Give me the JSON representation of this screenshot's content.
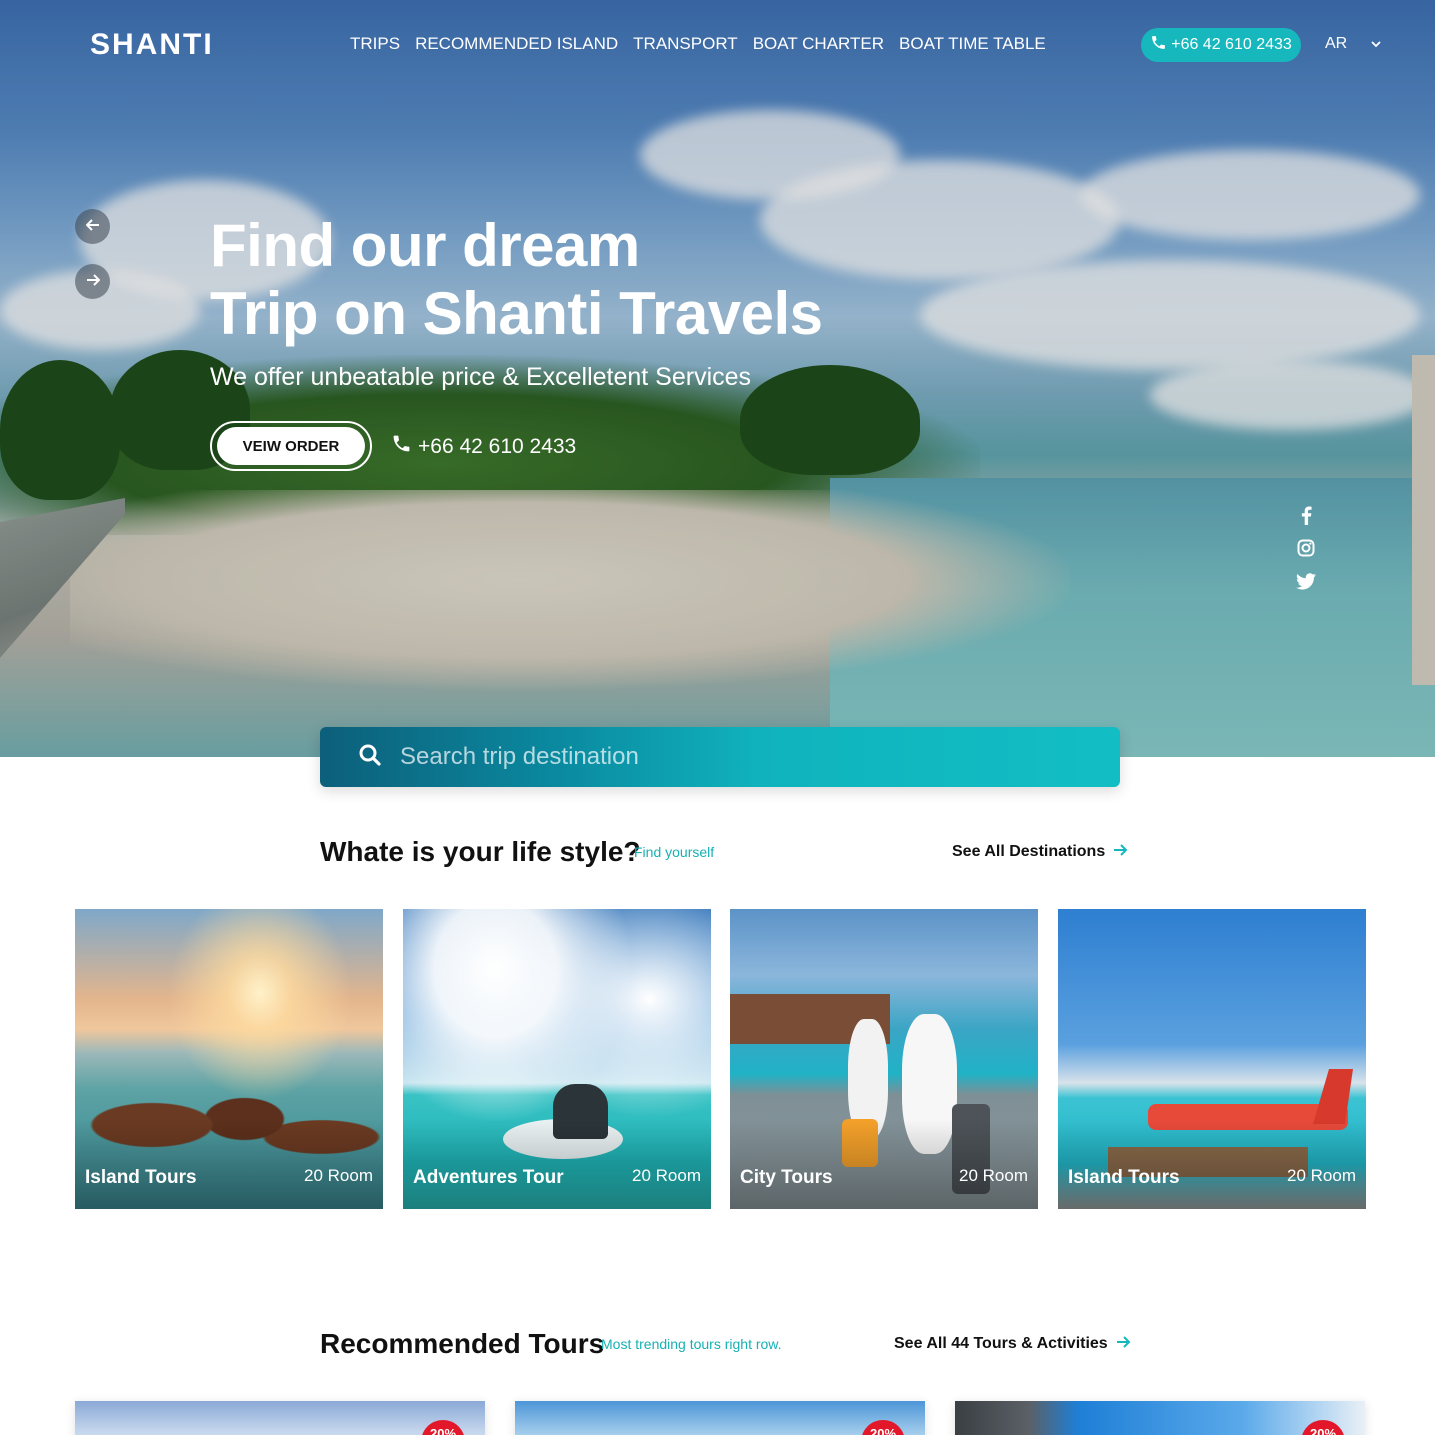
{
  "header": {
    "logo": "SHANTI",
    "nav": [
      {
        "label": "TRIPS"
      },
      {
        "label": "RECOMMENDED ISLAND"
      },
      {
        "label": "TRANSPORT"
      },
      {
        "label": "BOAT CHARTER"
      },
      {
        "label": "BOAT TIME TABLE"
      }
    ],
    "phone": "+66 42 610 2433",
    "language": "AR"
  },
  "hero": {
    "title_line1": "Find our dream",
    "title_line2": "Trip on Shanti Travels",
    "subtitle": "We offer unbeatable price & Excelletent Services",
    "order_button": "VEIW ORDER",
    "phone": "+66 42 610 2433",
    "social_icons": [
      "facebook-icon",
      "instagram-icon",
      "twitter-icon"
    ]
  },
  "search": {
    "placeholder": "Search trip destination"
  },
  "lifestyle": {
    "title": "Whate is your life style?",
    "subtitle": "Find yourself",
    "link": "See All Destinations",
    "cards": [
      {
        "name": "Island Tours",
        "rooms": "20 Room"
      },
      {
        "name": "Adventures Tour",
        "rooms": "20 Room"
      },
      {
        "name": "City Tours",
        "rooms": "20 Room"
      },
      {
        "name": "Island Tours",
        "rooms": "20 Room"
      }
    ]
  },
  "recommended": {
    "title": "Recommended Tours",
    "subtitle": "Most trending tours right row.",
    "link": "See All 44 Tours & Activities",
    "tours": [
      {
        "badge": "20%"
      },
      {
        "badge": "20%"
      },
      {
        "badge": "20%"
      }
    ]
  },
  "colors": {
    "accent": "#17b8bd",
    "badge": "#e3172a",
    "text": "#111111"
  }
}
